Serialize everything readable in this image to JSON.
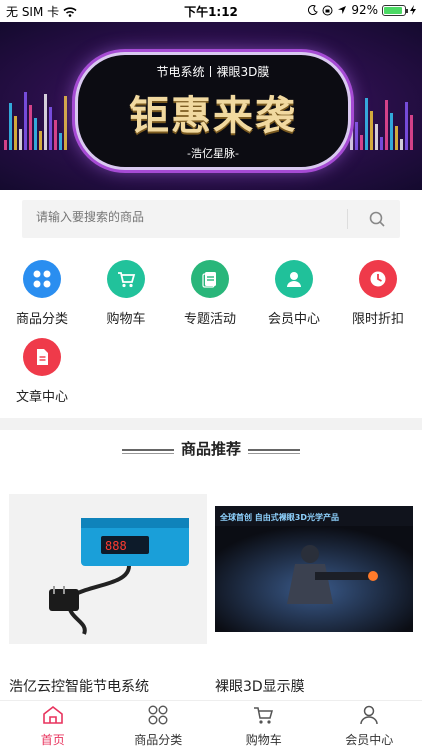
{
  "status_bar": {
    "carrier": "无 SIM 卡",
    "time": "下午1:12",
    "battery": "92%",
    "battery_level": 0.92
  },
  "banner": {
    "subtitle": "节电系统丨裸眼3D膜",
    "title": "钜惠来袭",
    "brand": "-浩亿星脉-"
  },
  "search": {
    "placeholder": "请输入要搜索的商品"
  },
  "quick_nav": [
    {
      "label": "商品分类",
      "icon": "grid-icon",
      "color": "#2a8ef0"
    },
    {
      "label": "购物车",
      "icon": "cart-icon",
      "color": "#21c29b"
    },
    {
      "label": "专题活动",
      "icon": "document-icon",
      "color": "#29b67a"
    },
    {
      "label": "会员中心",
      "icon": "user-icon",
      "color": "#20c19a"
    },
    {
      "label": "限时折扣",
      "icon": "clock-icon",
      "color": "#ef3a4a"
    },
    {
      "label": "文章中心",
      "icon": "article-icon",
      "color": "#ef3a4a"
    }
  ],
  "recommend": {
    "title": "商品推荐"
  },
  "products": [
    {
      "name": "浩亿云控智能节电系统",
      "image": "power-saver-device-image"
    },
    {
      "name": "裸眼3D显示膜",
      "image": "3d-film-game-image",
      "image_text": "全球首创 自由式裸眼3D光学产品"
    }
  ],
  "tabbar": [
    {
      "label": "首页",
      "icon": "home-icon",
      "active": true
    },
    {
      "label": "商品分类",
      "icon": "category-icon",
      "active": false
    },
    {
      "label": "购物车",
      "icon": "cart-icon",
      "active": false
    },
    {
      "label": "会员中心",
      "icon": "user-icon",
      "active": false
    }
  ],
  "colors": {
    "accent": "#e8345e"
  }
}
